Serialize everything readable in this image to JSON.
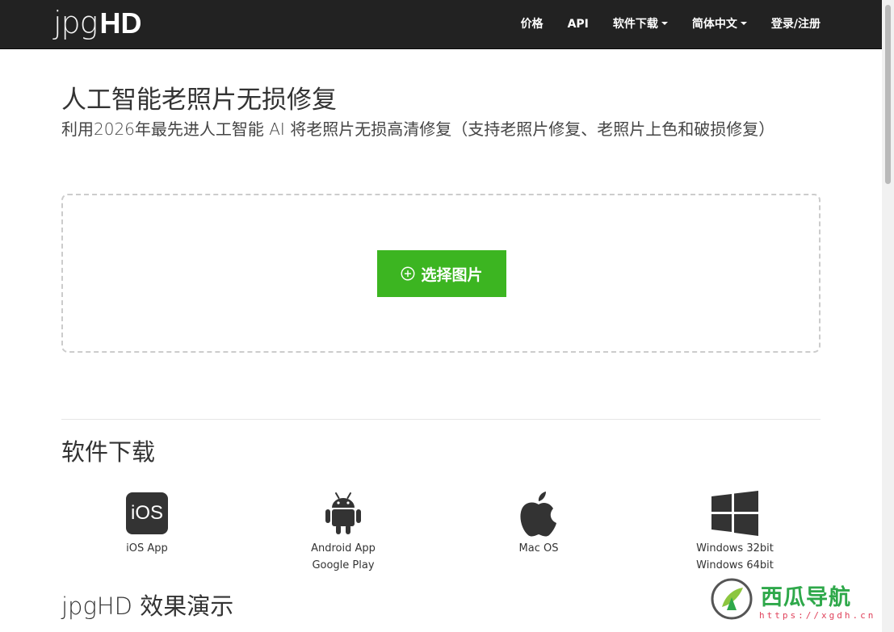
{
  "brand": {
    "light_text": "jpg",
    "bold_text": "HD"
  },
  "nav": {
    "items": [
      {
        "label": "价格",
        "dropdown": false
      },
      {
        "label": "API",
        "dropdown": false
      },
      {
        "label": "软件下载",
        "dropdown": true
      },
      {
        "label": "简体中文",
        "dropdown": true
      },
      {
        "label": "登录/注册",
        "dropdown": false
      }
    ]
  },
  "hero": {
    "title": "人工智能老照片无损修复",
    "subtitle": "利用2026年最先进人工智能 AI 将老照片无损高清修复（支持老照片修复、老照片上色和破损修复）"
  },
  "upload": {
    "button_label": "选择图片",
    "button_icon": "plus-circle-icon"
  },
  "downloads": {
    "title": "软件下载",
    "items": [
      {
        "icon": "ios-icon",
        "icon_text": "iOS",
        "lines": [
          "iOS App"
        ]
      },
      {
        "icon": "android-icon",
        "lines": [
          "Android App",
          "Google Play"
        ]
      },
      {
        "icon": "apple-icon",
        "lines": [
          "Mac OS"
        ]
      },
      {
        "icon": "windows-icon",
        "lines": [
          "Windows 32bit",
          "Windows 64bit"
        ]
      }
    ]
  },
  "demo": {
    "title": "jpgHD 效果演示"
  },
  "watermark": {
    "name": "西瓜导航",
    "url": "https://xgdh.cn"
  },
  "colors": {
    "navbar_bg": "#222222",
    "accent_green": "#3cb521",
    "text_dark": "#333333",
    "watermark_green": "#2ea84a",
    "watermark_red": "#e0425b"
  }
}
